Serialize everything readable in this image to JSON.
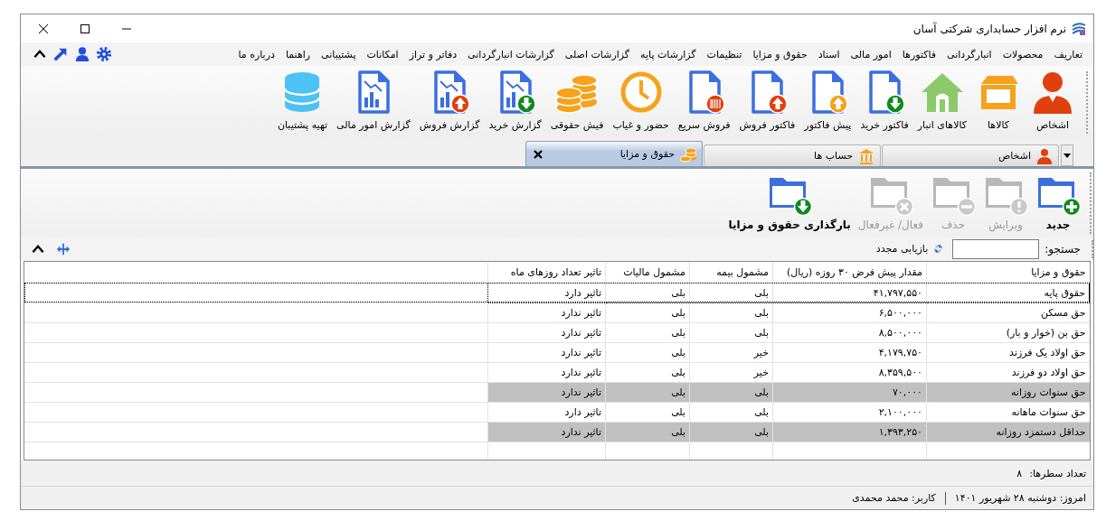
{
  "window": {
    "title": "نرم افزار حسابداری شرکتی آسان"
  },
  "menu": [
    "تعاریف",
    "محصولات",
    "انبارگردانی",
    "فاکتورها",
    "امور مالی",
    "اسناد",
    "حقوق و مزایا",
    "تنظیمات",
    "گزارشات پایه",
    "گزارشات اصلی",
    "گزارشات انبارگردانی",
    "دفاتر و تراز",
    "امکانات",
    "پشتیبانی",
    "راهنما",
    "درباره ما"
  ],
  "toolbar": [
    {
      "label": "اشخاص",
      "kind": "person"
    },
    {
      "label": "کالاها",
      "kind": "box"
    },
    {
      "label": "کالاهای انبار",
      "kind": "house"
    },
    {
      "label": "فاکتور خرید",
      "kind": "purchase-invoice"
    },
    {
      "label": "پیش فاکتور",
      "kind": "proforma"
    },
    {
      "label": "فاکتور فروش",
      "kind": "sales-invoice"
    },
    {
      "label": "فروش سریع",
      "kind": "quick-sale"
    },
    {
      "label": "حضور و غیاب",
      "kind": "attendance"
    },
    {
      "label": "فیش حقوقی",
      "kind": "payslip"
    },
    {
      "label": "گزارش خرید",
      "kind": "purchase-report"
    },
    {
      "label": "گزارش فروش",
      "kind": "sales-report"
    },
    {
      "label": "گزارش امور مالی",
      "kind": "finance-report"
    },
    {
      "label": "تهیه پشتیبان",
      "kind": "backup"
    }
  ],
  "tabs": [
    {
      "label": "اشخاص",
      "kind": "person",
      "selected": false
    },
    {
      "label": "حساب ها",
      "kind": "bank",
      "selected": false
    },
    {
      "label": "حقوق و مزایا",
      "kind": "coins",
      "selected": true
    }
  ],
  "actions": [
    {
      "label": "جدید",
      "kind": "add",
      "disabled": false
    },
    {
      "label": "ویرایش",
      "kind": "edit",
      "disabled": true
    },
    {
      "label": "حذف",
      "kind": "delete",
      "disabled": true
    },
    {
      "label": "فعال/ غیرفعال",
      "kind": "toggle",
      "disabled": true
    },
    {
      "label": "بارگذاری حقوق و مزایا",
      "kind": "import",
      "disabled": false
    }
  ],
  "search": {
    "label": "جستجو:",
    "reload": "بازیابی مجدد"
  },
  "table": {
    "columns": [
      "حقوق و مزایا",
      "مقدار پیش فرض ۳۰ روزه (ریال)",
      "مشمول بیمه",
      "مشمول مالیات",
      "تاثیر تعداد روزهای ماه"
    ],
    "rows": [
      {
        "cells": [
          "حقوق پایه",
          "۴۱,۷۹۷,۵۵۰",
          "بلی",
          "بلی",
          "تاثیر دارد"
        ],
        "selected": false,
        "focused": true
      },
      {
        "cells": [
          "حق مسکن",
          "۶,۵۰۰,۰۰۰",
          "بلی",
          "بلی",
          "تاثیر ندارد"
        ],
        "selected": false,
        "focused": false
      },
      {
        "cells": [
          "حق بن (خوار و بار)",
          "۸,۵۰۰,۰۰۰",
          "بلی",
          "بلی",
          "تاثیر ندارد"
        ],
        "selected": false,
        "focused": false
      },
      {
        "cells": [
          "حق اولاد یک فرزند",
          "۴,۱۷۹,۷۵۰",
          "خیر",
          "بلی",
          "تاثیر ندارد"
        ],
        "selected": false,
        "focused": false
      },
      {
        "cells": [
          "حق اولاد دو فرزند",
          "۸,۳۵۹,۵۰۰",
          "خیر",
          "بلی",
          "تاثیر ندارد"
        ],
        "selected": false,
        "focused": false
      },
      {
        "cells": [
          "حق سنوات روزانه",
          "۷۰,۰۰۰",
          "بلی",
          "بلی",
          "تاثیر ندارد"
        ],
        "selected": true,
        "focused": false
      },
      {
        "cells": [
          "حق سنوات ماهانه",
          "۲,۱۰۰,۰۰۰",
          "بلی",
          "بلی",
          "تاثیر دارد"
        ],
        "selected": false,
        "focused": false
      },
      {
        "cells": [
          "حداقل دستمزد روزانه",
          "۱,۳۹۳,۲۵۰",
          "بلی",
          "بلی",
          "تاثیر ندارد"
        ],
        "selected": true,
        "focused": false
      }
    ]
  },
  "row_count": {
    "label": "تعداد سطرها:",
    "value": "۸"
  },
  "status_bar": {
    "date": "امروز: دوشنبه ۲۸ شهریور ۱۴۰۱",
    "user": "کاربر: محمد محمدی"
  }
}
